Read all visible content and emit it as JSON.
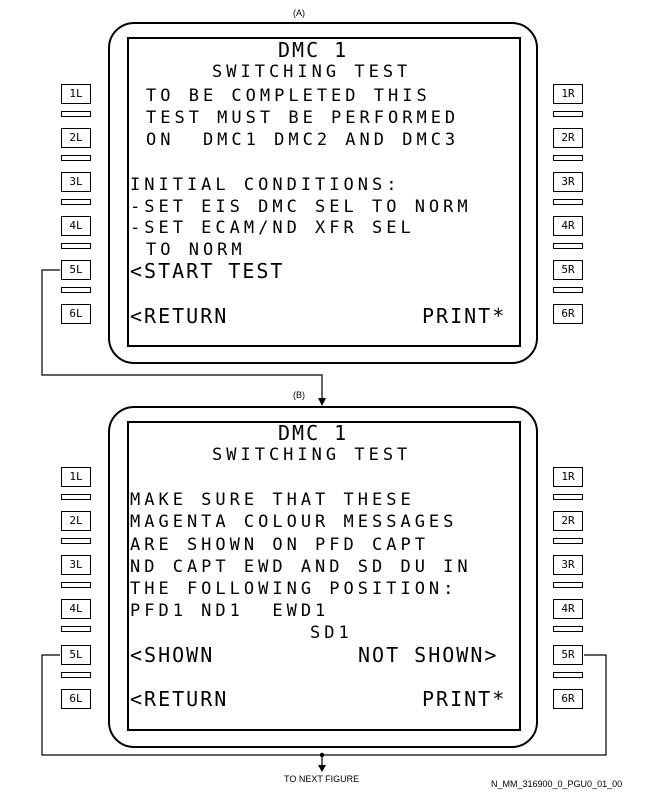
{
  "panels": [
    {
      "tag": "(A)",
      "lines": [
        "DMC 1",
        "SWITCHING TEST",
        "TO BE COMPLETED THIS",
        "TEST MUST BE PERFORMED",
        "ON  DMC1 DMC2 AND DMC3",
        "INITIAL CONDITIONS:",
        "-SET EIS DMC SEL TO NORM",
        "-SET ECAM/ND XFR SEL",
        "TO NORM",
        "<START TEST",
        "<RETURN",
        "PRINT*"
      ],
      "left_keys": [
        "1L",
        "2L",
        "3L",
        "4L",
        "5L",
        "6L"
      ],
      "right_keys": [
        "1R",
        "2R",
        "3R",
        "4R",
        "5R",
        "6R"
      ]
    },
    {
      "tag": "(B)",
      "lines": [
        "DMC 1",
        "SWITCHING TEST",
        "MAKE SURE THAT THESE",
        "MAGENTA COLOUR MESSAGES",
        "ARE SHOWN ON PFD CAPT",
        "ND CAPT EWD AND SD DU IN",
        "THE FOLLOWING POSITION:",
        "PFD1 ND1  EWD1",
        "SD1",
        "<SHOWN",
        "NOT SHOWN>",
        "<RETURN",
        "PRINT*"
      ],
      "left_keys": [
        "1L",
        "2L",
        "3L",
        "4L",
        "5L",
        "6L"
      ],
      "right_keys": [
        "1R",
        "2R",
        "3R",
        "4R",
        "5R",
        "6R"
      ]
    }
  ],
  "footer": {
    "next": "TO NEXT FIGURE",
    "ref": "N_MM_316900_0_PGU0_01_00"
  }
}
